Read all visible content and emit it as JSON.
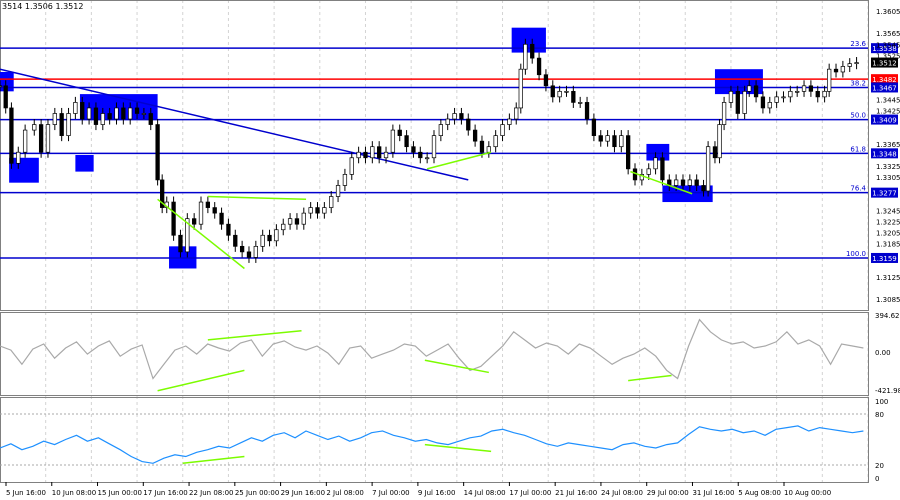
{
  "header": {
    "title": "3514 1.3506 1.3512"
  },
  "colors": {
    "bg": "#ffffff",
    "grid": "#d3d3d3",
    "candle": "#000000",
    "level_line": "#0000cd",
    "level_red": "#ff0000",
    "zone": "#0000ff",
    "divergence": "#7cfc00",
    "cci_line": "#a9a9a9",
    "rsi_line": "#1e90ff",
    "price_label_bg": "#0000ff",
    "current_price_bg": "#000000"
  },
  "chart_data": [
    {
      "type": "candlestick",
      "instrument_title": "3514 1.3506 1.3512",
      "ylim": [
        1.3065,
        1.3625
      ],
      "price_ticks": [
        "1.3605",
        "1.3565",
        "1.3545",
        "1.3525",
        "1.3445",
        "1.3425",
        "1.3365",
        "1.3325",
        "1.3305",
        "1.3245",
        "1.3225",
        "1.3205",
        "1.3185",
        "1.3125",
        "1.3085"
      ],
      "time_labels": [
        "5 Jun 16:00",
        "10 Jun 08:00",
        "15 Jun 00:00",
        "17 Jun 16:00",
        "22 Jun 08:00",
        "25 Jun 00:00",
        "29 Jun 16:00",
        "2 Jul 08:00",
        "7 Jul 00:00",
        "9 Jul 16:00",
        "14 Jul 08:00",
        "17 Jul 00:00",
        "21 Jul 16:00",
        "24 Jul 08:00",
        "29 Jul 00:00",
        "31 Jul 16:00",
        "5 Aug 08:00",
        "10 Aug 00:00"
      ],
      "series": [
        {
          "index": 0,
          "close": 1.347
        },
        {
          "index": 5,
          "close": 1.343
        },
        {
          "index": 10,
          "close": 1.333
        },
        {
          "index": 16,
          "close": 1.335
        },
        {
          "index": 22,
          "close": 1.339
        },
        {
          "index": 30,
          "close": 1.34
        },
        {
          "index": 36,
          "close": 1.335
        },
        {
          "index": 42,
          "close": 1.34
        },
        {
          "index": 48,
          "close": 1.342
        },
        {
          "index": 54,
          "close": 1.338
        },
        {
          "index": 60,
          "close": 1.342
        },
        {
          "index": 66,
          "close": 1.344
        },
        {
          "index": 72,
          "close": 1.341
        },
        {
          "index": 78,
          "close": 1.343
        },
        {
          "index": 84,
          "close": 1.34
        },
        {
          "index": 90,
          "close": 1.342
        },
        {
          "index": 96,
          "close": 1.341
        },
        {
          "index": 102,
          "close": 1.343
        },
        {
          "index": 108,
          "close": 1.341
        },
        {
          "index": 114,
          "close": 1.343
        },
        {
          "index": 120,
          "close": 1.342
        },
        {
          "index": 126,
          "close": 1.342
        },
        {
          "index": 132,
          "close": 1.34
        },
        {
          "index": 138,
          "close": 1.33
        },
        {
          "index": 142,
          "close": 1.325
        },
        {
          "index": 146,
          "close": 1.326
        },
        {
          "index": 152,
          "close": 1.32
        },
        {
          "index": 158,
          "close": 1.317
        },
        {
          "index": 164,
          "close": 1.323
        },
        {
          "index": 170,
          "close": 1.322
        },
        {
          "index": 176,
          "close": 1.326
        },
        {
          "index": 182,
          "close": 1.325
        },
        {
          "index": 188,
          "close": 1.324
        },
        {
          "index": 194,
          "close": 1.322
        },
        {
          "index": 200,
          "close": 1.32
        },
        {
          "index": 206,
          "close": 1.318
        },
        {
          "index": 212,
          "close": 1.317
        },
        {
          "index": 218,
          "close": 1.316
        },
        {
          "index": 224,
          "close": 1.318
        },
        {
          "index": 230,
          "close": 1.32
        },
        {
          "index": 236,
          "close": 1.319
        },
        {
          "index": 242,
          "close": 1.321
        },
        {
          "index": 248,
          "close": 1.322
        },
        {
          "index": 254,
          "close": 1.323
        },
        {
          "index": 260,
          "close": 1.322
        },
        {
          "index": 266,
          "close": 1.324
        },
        {
          "index": 272,
          "close": 1.325
        },
        {
          "index": 278,
          "close": 1.324
        },
        {
          "index": 284,
          "close": 1.325
        },
        {
          "index": 290,
          "close": 1.327
        },
        {
          "index": 296,
          "close": 1.329
        },
        {
          "index": 302,
          "close": 1.331
        },
        {
          "index": 308,
          "close": 1.334
        },
        {
          "index": 314,
          "close": 1.335
        },
        {
          "index": 320,
          "close": 1.334
        },
        {
          "index": 326,
          "close": 1.336
        },
        {
          "index": 332,
          "close": 1.334
        },
        {
          "index": 338,
          "close": 1.335
        },
        {
          "index": 344,
          "close": 1.339
        },
        {
          "index": 350,
          "close": 1.338
        },
        {
          "index": 356,
          "close": 1.336
        },
        {
          "index": 362,
          "close": 1.335
        },
        {
          "index": 368,
          "close": 1.334
        },
        {
          "index": 374,
          "close": 1.334
        },
        {
          "index": 380,
          "close": 1.338
        },
        {
          "index": 386,
          "close": 1.34
        },
        {
          "index": 392,
          "close": 1.341
        },
        {
          "index": 398,
          "close": 1.342
        },
        {
          "index": 404,
          "close": 1.341
        },
        {
          "index": 410,
          "close": 1.339
        },
        {
          "index": 416,
          "close": 1.337
        },
        {
          "index": 422,
          "close": 1.335
        },
        {
          "index": 428,
          "close": 1.336
        },
        {
          "index": 434,
          "close": 1.338
        },
        {
          "index": 440,
          "close": 1.34
        },
        {
          "index": 446,
          "close": 1.341
        },
        {
          "index": 452,
          "close": 1.343
        },
        {
          "index": 456,
          "close": 1.35
        },
        {
          "index": 460,
          "close": 1.3545
        },
        {
          "index": 466,
          "close": 1.352
        },
        {
          "index": 472,
          "close": 1.349
        },
        {
          "index": 478,
          "close": 1.347
        },
        {
          "index": 484,
          "close": 1.345
        },
        {
          "index": 490,
          "close": 1.346
        },
        {
          "index": 496,
          "close": 1.346
        },
        {
          "index": 502,
          "close": 1.344
        },
        {
          "index": 508,
          "close": 1.344
        },
        {
          "index": 514,
          "close": 1.341
        },
        {
          "index": 520,
          "close": 1.338
        },
        {
          "index": 526,
          "close": 1.337
        },
        {
          "index": 532,
          "close": 1.338
        },
        {
          "index": 538,
          "close": 1.336
        },
        {
          "index": 544,
          "close": 1.338
        },
        {
          "index": 550,
          "close": 1.332
        },
        {
          "index": 556,
          "close": 1.33
        },
        {
          "index": 562,
          "close": 1.331
        },
        {
          "index": 568,
          "close": 1.332
        },
        {
          "index": 574,
          "close": 1.334
        },
        {
          "index": 580,
          "close": 1.33
        },
        {
          "index": 586,
          "close": 1.329
        },
        {
          "index": 592,
          "close": 1.33
        },
        {
          "index": 598,
          "close": 1.329
        },
        {
          "index": 604,
          "close": 1.33
        },
        {
          "index": 610,
          "close": 1.329
        },
        {
          "index": 616,
          "close": 1.328
        },
        {
          "index": 620,
          "close": 1.336
        },
        {
          "index": 626,
          "close": 1.334
        },
        {
          "index": 630,
          "close": 1.34
        },
        {
          "index": 634,
          "close": 1.344
        },
        {
          "index": 640,
          "close": 1.346
        },
        {
          "index": 646,
          "close": 1.342
        },
        {
          "index": 652,
          "close": 1.346
        },
        {
          "index": 656,
          "close": 1.347
        },
        {
          "index": 662,
          "close": 1.345
        },
        {
          "index": 668,
          "close": 1.343
        },
        {
          "index": 674,
          "close": 1.344
        },
        {
          "index": 680,
          "close": 1.345
        },
        {
          "index": 686,
          "close": 1.345
        },
        {
          "index": 692,
          "close": 1.346
        },
        {
          "index": 698,
          "close": 1.346
        },
        {
          "index": 704,
          "close": 1.347
        },
        {
          "index": 710,
          "close": 1.346
        },
        {
          "index": 716,
          "close": 1.345
        },
        {
          "index": 722,
          "close": 1.346
        },
        {
          "index": 726,
          "close": 1.35
        },
        {
          "index": 732,
          "close": 1.3495
        },
        {
          "index": 738,
          "close": 1.3505
        },
        {
          "index": 744,
          "close": 1.351
        },
        {
          "index": 750,
          "close": 1.3512
        }
      ],
      "levels": [
        {
          "fib": "23.6",
          "price": "1.3538",
          "color": "#0000cd"
        },
        {
          "fib": "",
          "price": "1.3482",
          "color": "#ff0000"
        },
        {
          "fib": "38.2",
          "price": "1.3467",
          "color": "#0000cd"
        },
        {
          "fib": "50.0",
          "price": "1.3409",
          "color": "#0000cd"
        },
        {
          "fib": "61.8",
          "price": "1.3348",
          "color": "#0000cd"
        },
        {
          "fib": "76.4",
          "price": "1.3277",
          "color": "#0000cd"
        },
        {
          "fib": "100.0",
          "price": "1.3159",
          "color": "#0000cd"
        }
      ],
      "current_price": "1.3512",
      "trendline": {
        "from": {
          "index": 0,
          "price": 1.35
        },
        "to": {
          "index": 410,
          "price": 1.33
        }
      },
      "zones": [
        {
          "x0": 0,
          "x1": 12,
          "y0": 1.3495,
          "y1": 1.346
        },
        {
          "x0": 8,
          "x1": 34,
          "y0": 1.334,
          "y1": 1.3295
        },
        {
          "x0": 66,
          "x1": 82,
          "y0": 1.3345,
          "y1": 1.3315
        },
        {
          "x0": 70,
          "x1": 138,
          "y0": 1.3455,
          "y1": 1.341
        },
        {
          "x0": 148,
          "x1": 172,
          "y0": 1.318,
          "y1": 1.314
        },
        {
          "x0": 448,
          "x1": 478,
          "y0": 1.3575,
          "y1": 1.353
        },
        {
          "x0": 566,
          "x1": 586,
          "y0": 1.3365,
          "y1": 1.3335
        },
        {
          "x0": 580,
          "x1": 624,
          "y0": 1.329,
          "y1": 1.326
        },
        {
          "x0": 626,
          "x1": 668,
          "y0": 1.35,
          "y1": 1.3455
        }
      ],
      "divergences": [
        {
          "from": {
            "index": 138,
            "price": 1.3265
          },
          "to": {
            "index": 214,
            "price": 1.314
          }
        },
        {
          "from": {
            "index": 182,
            "price": 1.327
          },
          "to": {
            "index": 268,
            "price": 1.3265
          }
        },
        {
          "from": {
            "index": 374,
            "price": 1.332
          },
          "to": {
            "index": 430,
            "price": 1.335
          }
        },
        {
          "from": {
            "index": 552,
            "price": 1.3315
          },
          "to": {
            "index": 606,
            "price": 1.3275
          }
        }
      ]
    },
    {
      "type": "line",
      "indicator": "oscillator_1",
      "ylim": [
        -421.9876,
        394.6289
      ],
      "tick_labels": [
        "394.6289",
        "0.00",
        "-421.987"
      ],
      "series": [
        {
          "values": [
            60,
            20,
            -120,
            30,
            80,
            -60,
            40,
            100,
            -20,
            60,
            110,
            -40,
            30,
            70,
            -260,
            -120,
            20,
            60,
            -20,
            80,
            40,
            10,
            90,
            120,
            -40,
            80,
            110,
            50,
            20,
            60,
            -10,
            -120,
            40,
            60,
            -60,
            -20,
            20,
            80,
            60,
            -40,
            20,
            80,
            -60,
            -180,
            -140,
            -40,
            60,
            200,
            120,
            40,
            90,
            60,
            -20,
            80,
            40,
            -40,
            -120,
            -60,
            -20,
            40,
            -40,
            -180,
            -260,
            60,
            320,
            200,
            120,
            80,
            100,
            40,
            60,
            100,
            200,
            80,
            120,
            60,
            -120,
            80,
            60,
            40
          ]
        }
      ],
      "divergences": [
        {
          "from": {
            "index": 138,
            "value": -380
          },
          "to": {
            "index": 214,
            "value": -180
          }
        },
        {
          "from": {
            "index": 182,
            "value": 120
          },
          "to": {
            "index": 264,
            "value": 210
          }
        },
        {
          "from": {
            "index": 372,
            "value": -80
          },
          "to": {
            "index": 428,
            "value": -200
          }
        },
        {
          "from": {
            "index": 550,
            "value": -280
          },
          "to": {
            "index": 588,
            "value": -230
          }
        }
      ]
    },
    {
      "type": "line",
      "indicator": "oscillator_2",
      "ylim": [
        0,
        100
      ],
      "tick_labels": [
        "100",
        "80",
        "20",
        "0"
      ],
      "series": [
        {
          "values": [
            40,
            45,
            38,
            42,
            48,
            44,
            50,
            55,
            48,
            52,
            45,
            38,
            30,
            24,
            22,
            28,
            32,
            30,
            35,
            38,
            42,
            40,
            46,
            52,
            48,
            55,
            58,
            52,
            60,
            55,
            50,
            54,
            48,
            52,
            58,
            60,
            55,
            52,
            48,
            50,
            46,
            44,
            48,
            52,
            54,
            60,
            62,
            58,
            55,
            50,
            45,
            42,
            46,
            44,
            42,
            40,
            38,
            44,
            46,
            42,
            40,
            44,
            46,
            56,
            65,
            62,
            60,
            62,
            58,
            60,
            55,
            62,
            64,
            66,
            60,
            64,
            62,
            60,
            58,
            60
          ]
        }
      ],
      "divergences": [
        {
          "from": {
            "index": 160,
            "value": 22
          },
          "to": {
            "index": 214,
            "value": 30
          }
        },
        {
          "from": {
            "index": 372,
            "value": 44
          },
          "to": {
            "index": 430,
            "value": 36
          }
        }
      ]
    }
  ]
}
